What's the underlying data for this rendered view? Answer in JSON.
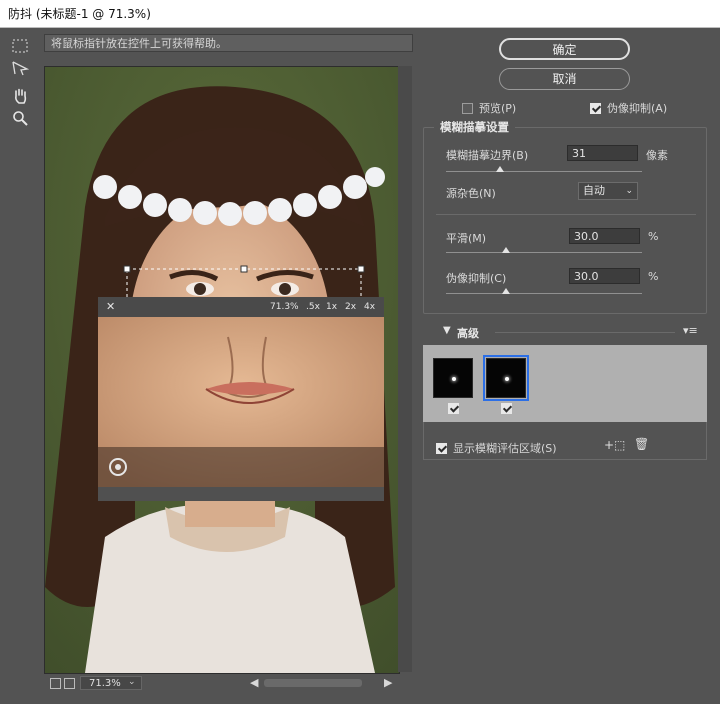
{
  "window": {
    "title": "防抖 (未标题-1 @ 71.3%)"
  },
  "hint": {
    "text": "将鼠标指针放在控件上可获得帮助。"
  },
  "tools": [
    "marquee-icon",
    "blur-trace-icon",
    "hand-icon",
    "zoom-icon"
  ],
  "buttons": {
    "ok": "确定",
    "cancel": "取消"
  },
  "options": {
    "preview_label": "预览(P)",
    "preview_checked": false,
    "artifact_label": "伪像抑制(A)",
    "artifact_checked": true
  },
  "blur_trace": {
    "section_title": "模糊描摹设置",
    "bounds_label": "模糊描摹边界(B)",
    "bounds_value": "31",
    "bounds_unit": "像素",
    "noise_label": "源杂色(N)",
    "noise_value": "自动",
    "smooth_label": "平滑(M)",
    "smooth_value": "30.0",
    "smooth_unit": "%",
    "suppress_label": "伪像抑制(C)",
    "suppress_value": "30.0",
    "suppress_unit": "%"
  },
  "advanced": {
    "title": "高级",
    "show_regions_label": "显示模糊评估区域(S)",
    "show_regions_checked": true
  },
  "loupe": {
    "zoom_options": [
      "71.3%",
      ".5x",
      "1x",
      "2x",
      "4x"
    ]
  },
  "status": {
    "zoom": "71.3%"
  },
  "colors": {
    "accent": "#2c6fe6",
    "panel": "#535353"
  }
}
